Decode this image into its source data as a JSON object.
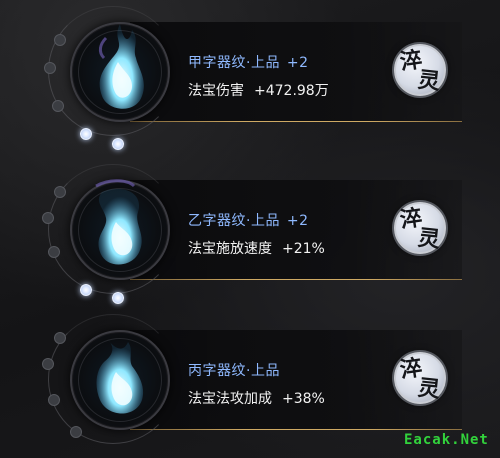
{
  "inscriptions": [
    {
      "title_prefix": "甲字器纹",
      "title_sep": "·",
      "title_rank": "上品",
      "title_tail": "+2",
      "stat_name": "法宝伤害",
      "stat_value": "+472.98万",
      "button_glyphs": [
        "淬",
        "灵"
      ],
      "lit_dots": 2
    },
    {
      "title_prefix": "乙字器纹",
      "title_sep": "·",
      "title_rank": "上品",
      "title_tail": "+2",
      "stat_name": "法宝施放速度",
      "stat_value": "+21%",
      "button_glyphs": [
        "淬",
        "灵"
      ],
      "lit_dots": 2
    },
    {
      "title_prefix": "丙字器纹",
      "title_sep": "·",
      "title_rank": "上品",
      "title_tail": "",
      "stat_name": "法宝法攻加成",
      "stat_value": "+38%",
      "button_glyphs": [
        "淬",
        "灵"
      ],
      "lit_dots": 0
    }
  ],
  "watermark": "Eacak.Net",
  "colors": {
    "title": "#8fb9ff",
    "stat": "#f2f2f2",
    "gold_line": "#d6b068",
    "flame": "#7fe9ff",
    "watermark": "#32d23c"
  },
  "icons": {
    "slot": "blue-spirit-flame-icon",
    "button": "refine-spirit-button"
  }
}
